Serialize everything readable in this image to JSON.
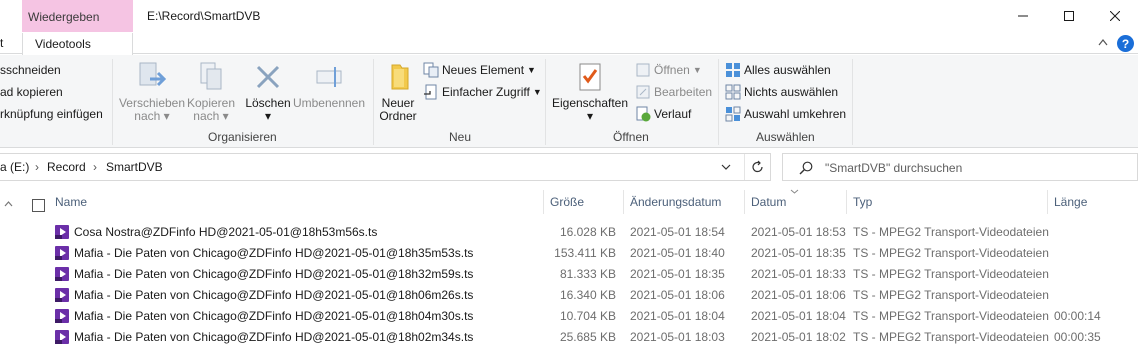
{
  "window": {
    "context_tab": "Wiedergeben",
    "title": "E:\\Record\\SmartDVB",
    "minimize_glyph": "—",
    "maximize_glyph": "☐",
    "close_glyph": "✕"
  },
  "ribbon_tabs": {
    "partial_tab": "t",
    "active_tab": "Videotools",
    "collapse_glyph": "^",
    "help_glyph": "?"
  },
  "ribbon": {
    "clipboard": {
      "cut": "sschneiden",
      "copy_path": "ad kopieren",
      "paste_shortcut": "rknüpfung einfügen"
    },
    "organize": {
      "group_label": "Organisieren",
      "move_to_line1": "Verschieben",
      "move_to_line2": "nach",
      "copy_to_line1": "Kopieren",
      "copy_to_line2": "nach",
      "delete": "Löschen",
      "rename": "Umbenennen"
    },
    "new": {
      "group_label": "Neu",
      "new_folder_line1": "Neuer",
      "new_folder_line2": "Ordner",
      "new_item": "Neues Element",
      "easy_access": "Einfacher Zugriff"
    },
    "open": {
      "group_label": "Öffnen",
      "properties": "Eigenschaften",
      "open": "Öffnen",
      "edit": "Bearbeiten",
      "history": "Verlauf"
    },
    "select": {
      "group_label": "Auswählen",
      "select_all": "Alles auswählen",
      "select_none": "Nichts auswählen",
      "invert_selection": "Auswahl umkehren"
    }
  },
  "address": {
    "crumbs": [
      "a (E:)",
      "Record",
      "SmartDVB"
    ],
    "search_placeholder": "\"SmartDVB\" durchsuchen"
  },
  "columns": {
    "name": "Name",
    "size": "Größe",
    "modified": "Änderungsdatum",
    "date": "Datum",
    "type": "Typ",
    "length": "Länge"
  },
  "files": [
    {
      "name": "Cosa Nostra@ZDFinfo HD@2021-05-01@18h53m56s.ts",
      "size": "16.028 KB",
      "modified": "2021-05-01 18:54",
      "date": "2021-05-01 18:53",
      "type": "TS - MPEG2 Transport-Videodateien",
      "length": ""
    },
    {
      "name": "Mafia - Die Paten von Chicago@ZDFinfo HD@2021-05-01@18h35m53s.ts",
      "size": "153.411 KB",
      "modified": "2021-05-01 18:40",
      "date": "2021-05-01 18:35",
      "type": "TS - MPEG2 Transport-Videodateien",
      "length": ""
    },
    {
      "name": "Mafia - Die Paten von Chicago@ZDFinfo HD@2021-05-01@18h32m59s.ts",
      "size": "81.333 KB",
      "modified": "2021-05-01 18:35",
      "date": "2021-05-01 18:33",
      "type": "TS - MPEG2 Transport-Videodateien",
      "length": ""
    },
    {
      "name": "Mafia - Die Paten von Chicago@ZDFinfo HD@2021-05-01@18h06m26s.ts",
      "size": "16.340 KB",
      "modified": "2021-05-01 18:06",
      "date": "2021-05-01 18:06",
      "type": "TS - MPEG2 Transport-Videodateien",
      "length": ""
    },
    {
      "name": "Mafia - Die Paten von Chicago@ZDFinfo HD@2021-05-01@18h04m30s.ts",
      "size": "10.704 KB",
      "modified": "2021-05-01 18:04",
      "date": "2021-05-01 18:04",
      "type": "TS - MPEG2 Transport-Videodateien",
      "length": "00:00:14"
    },
    {
      "name": "Mafia - Die Paten von Chicago@ZDFinfo HD@2021-05-01@18h02m34s.ts",
      "size": "25.685 KB",
      "modified": "2021-05-01 18:03",
      "date": "2021-05-01 18:02",
      "type": "TS - MPEG2 Transport-Videodateien",
      "length": "00:00:35"
    }
  ],
  "colors": {
    "context_tab": "#f5c4e3",
    "accent": "#1a6ed8",
    "column_header": "#4c607a",
    "ts_icon": "#6b2fa8"
  }
}
